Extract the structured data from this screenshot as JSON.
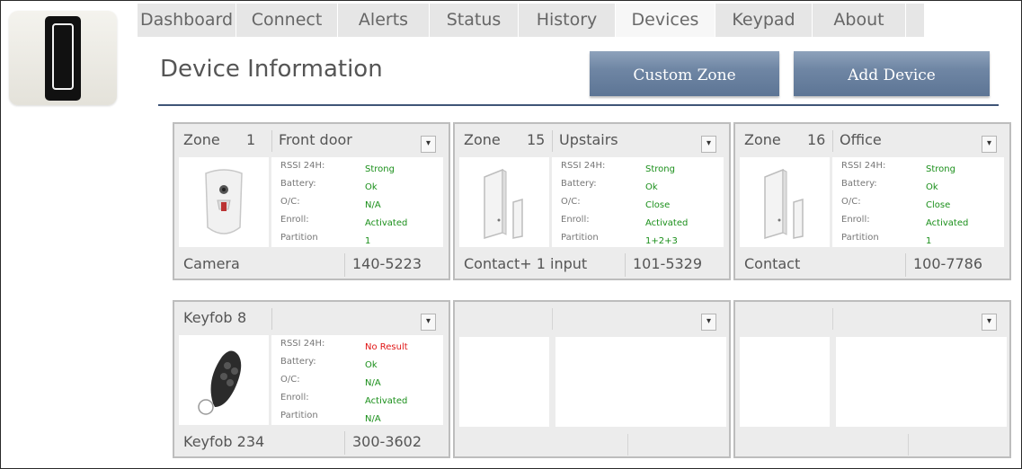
{
  "tabs": [
    "Dashboard",
    "Connect",
    "Alerts",
    "Status",
    "History",
    "Devices",
    "Keypad",
    "About"
  ],
  "active_tab": "Devices",
  "page_title": "Device Information",
  "buttons": {
    "custom_zone": "Custom Zone",
    "add_device": "Add Device"
  },
  "info_labels": {
    "rssi": "RSSI 24H:",
    "battery": "Battery:",
    "oc": "O/C:",
    "enroll": "Enroll:",
    "partition": "Partition"
  },
  "dropdown_glyph": "▾",
  "colors": {
    "ok": "#1a8f1a",
    "error": "#e01515",
    "button": "#6f86a4",
    "rule": "#3f5577"
  },
  "devices": [
    {
      "label": "Zone",
      "number": "1",
      "name": "Front door",
      "icon": "motion-camera-icon",
      "rssi": "Strong",
      "battery": "Ok",
      "oc": "N/A",
      "enroll": "Activated",
      "partition": "1",
      "type": "Camera",
      "code": "140-5223"
    },
    {
      "label": "Zone",
      "number": "15",
      "name": "Upstairs",
      "icon": "door-contact-icon",
      "rssi": "Strong",
      "battery": "Ok",
      "oc": "Close",
      "enroll": "Activated",
      "partition": "1+2+3",
      "type": "Contact+ 1 input",
      "code": "101-5329"
    },
    {
      "label": "Zone",
      "number": "16",
      "name": "Office",
      "icon": "door-contact-icon",
      "rssi": "Strong",
      "battery": "Ok",
      "oc": "Close",
      "enroll": "Activated",
      "partition": "1",
      "type": "Contact",
      "code": "100-7786"
    },
    {
      "label": "Keyfob",
      "number": "8",
      "name": "",
      "icon": "keyfob-icon",
      "rssi": "No Result",
      "battery": "Ok",
      "oc": "N/A",
      "enroll": "Activated",
      "partition": "N/A",
      "type": "Keyfob 234",
      "code": "300-3602"
    }
  ]
}
